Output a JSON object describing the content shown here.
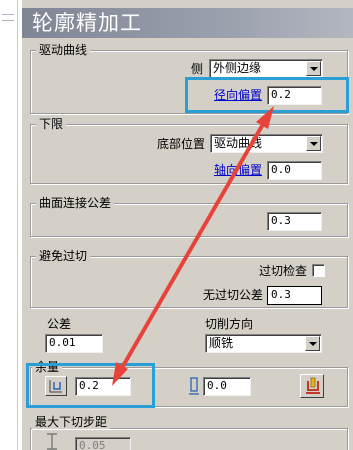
{
  "window": {
    "title": "轮廓精加工"
  },
  "drive_curve": {
    "group_title": "驱动曲线",
    "side_label": "侧",
    "side_value": "外侧边缘",
    "radial_offset_label": "径向偏置",
    "radial_offset_value": "0.2"
  },
  "lower_limit": {
    "group_title": "下限",
    "bottom_position_label": "底部位置",
    "bottom_position_value": "驱动曲线",
    "axial_offset_label": "轴向偏置",
    "axial_offset_value": "0.0"
  },
  "surface_tolerance": {
    "group_title": "曲面连接公差",
    "value": "0.3"
  },
  "gouge_avoid": {
    "group_title": "避免过切",
    "check_label": "过切检查",
    "check_checked": false,
    "tolerance_label": "无过切公差",
    "tolerance_value": "0.3"
  },
  "tolerance": {
    "label": "公差",
    "value": "0.01"
  },
  "cut_direction": {
    "label": "切削方向",
    "value": "顺铣"
  },
  "stock": {
    "label": "余量",
    "value": "0.2",
    "second_value": "0.0"
  },
  "max_stepdown": {
    "label": "最大下切步距",
    "value": "0.05"
  },
  "colors": {
    "highlight": "#2a9fd6",
    "arrow": "#e8433a",
    "panel": "#d4d0c8",
    "link": "#0000cc"
  }
}
